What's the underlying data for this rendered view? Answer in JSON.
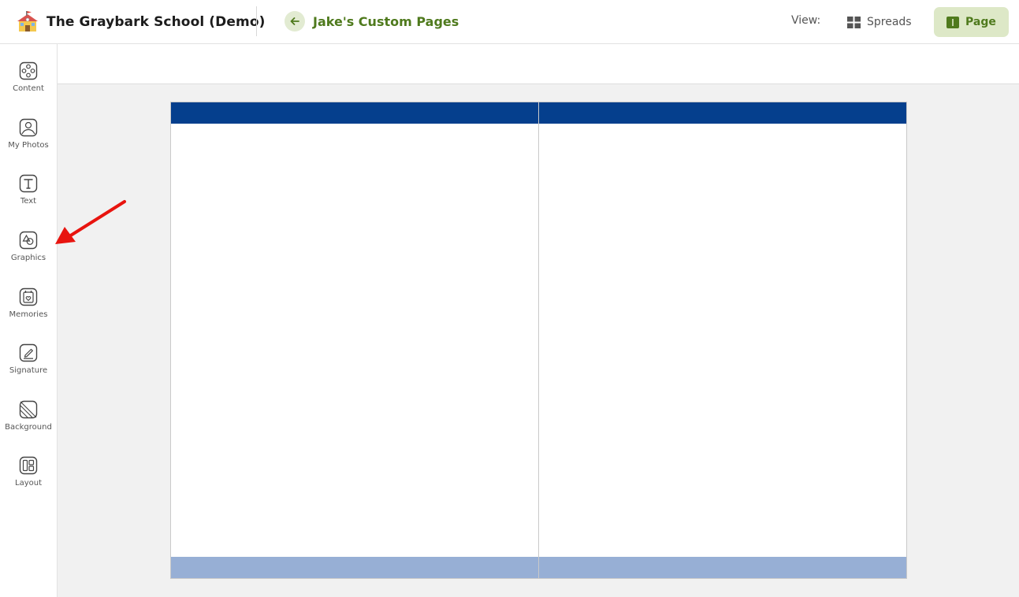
{
  "app": {
    "school_name": "The Graybark School (Demo)",
    "page_title": "Jake's Custom Pages"
  },
  "view": {
    "label": "View:",
    "options": [
      {
        "label": "Spreads",
        "active": false
      },
      {
        "label": "Page",
        "active": true
      }
    ]
  },
  "sidebar": {
    "items": [
      {
        "label": "Content",
        "icon": "content-icon"
      },
      {
        "label": "My Photos",
        "icon": "photos-icon"
      },
      {
        "label": "Text",
        "icon": "text-icon"
      },
      {
        "label": "Graphics",
        "icon": "graphics-icon"
      },
      {
        "label": "Memories",
        "icon": "memories-icon"
      },
      {
        "label": "Signature",
        "icon": "signature-icon"
      },
      {
        "label": "Background",
        "icon": "background-icon"
      },
      {
        "label": "Layout",
        "icon": "layout-icon"
      }
    ]
  },
  "colors": {
    "accent_green": "#4f7a1d",
    "header_band": "#053f8d",
    "footer_band": "#97afd5",
    "annotation_arrow": "#e8140f"
  }
}
